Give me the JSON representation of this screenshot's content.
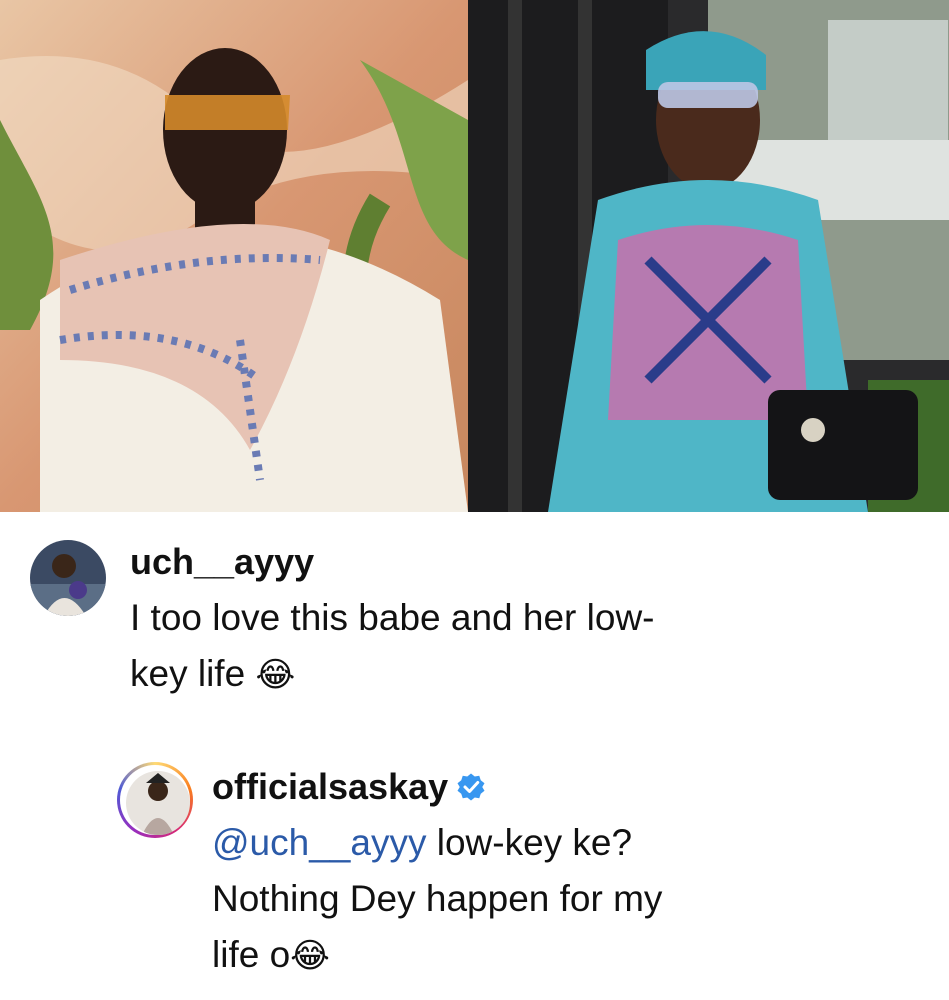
{
  "photos": {
    "left_alt": "",
    "right_alt": ""
  },
  "comments": [
    {
      "username": "uch__ayyy",
      "text_line1": "I too love this babe and her low-",
      "text_line2": "key life",
      "emoji": "😂"
    },
    {
      "username": "officialsaskay",
      "verified": true,
      "mention": "@uch__ayyy",
      "text_line1_rest": " low-key ke?",
      "text_line2": "Nothing Dey happen for my",
      "text_line3": "life o",
      "emoji": "😂"
    }
  ],
  "colors": {
    "mention": "#2b5aa8",
    "verified_badge": "#3897f0"
  },
  "icons": [
    "verified-badge-icon",
    "laughing-emoji-icon"
  ]
}
